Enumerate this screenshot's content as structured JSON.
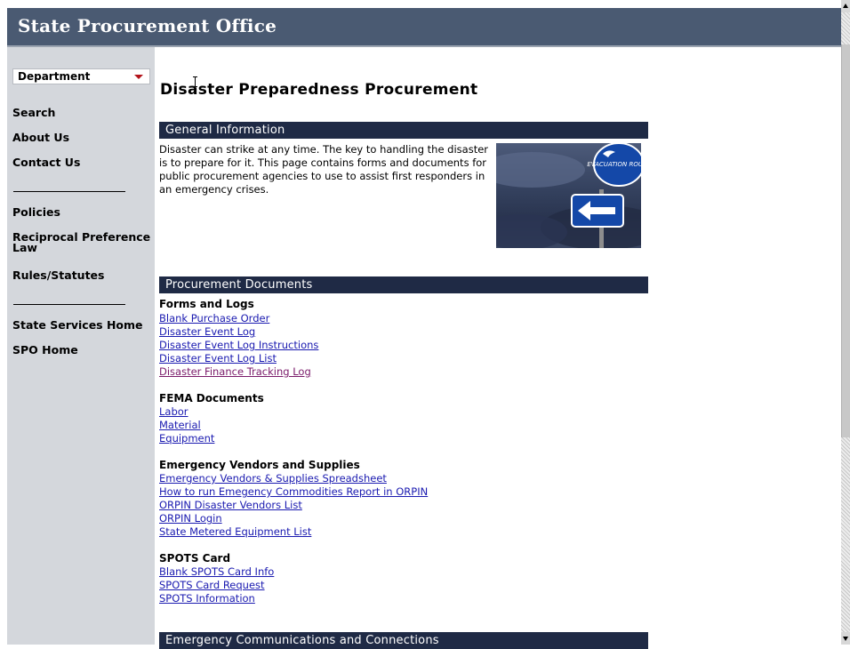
{
  "header": {
    "title": "State Procurement Office"
  },
  "sidebar": {
    "dropdown_value": "Department",
    "items": [
      {
        "label": "Search"
      },
      {
        "label": "About Us"
      },
      {
        "label": "Contact Us"
      },
      {
        "label": "Policies"
      },
      {
        "label": "Reciprocal Preference Law"
      },
      {
        "label": "Rules/Statutes"
      },
      {
        "label": "State Services Home"
      },
      {
        "label": "SPO Home"
      }
    ]
  },
  "main": {
    "page_title": "Disaster Preparedness Procurement",
    "general": {
      "heading": "General Information",
      "text": "Disaster can strike at any time.  The key to handling the disaster is to prepare for it.  This page contains forms and documents for public procurement agencies to use to assist first responders in an emergency crises.",
      "image_sign_text": "EVACUATION ROUTE"
    },
    "procurement": {
      "heading": "Procurement Documents",
      "groups": [
        {
          "title": "Forms and Logs",
          "links": [
            "Blank Purchase Order",
            "Disaster Event Log",
            "Disaster Event Log Instructions",
            "Disaster Event Log List",
            "Disaster Finance Tracking Log"
          ]
        },
        {
          "title": "FEMA Documents",
          "links": [
            "Labor",
            "Material",
            "Equipment"
          ]
        },
        {
          "title": "Emergency Vendors and Supplies",
          "links": [
            "Emergency Vendors & Supplies Spreadsheet",
            "How to run Emegency Commodities Report in ORPIN",
            "ORPIN Disaster Vendors List",
            "ORPIN Login",
            "State Metered Equipment List"
          ]
        },
        {
          "title": "SPOTS Card",
          "links": [
            "Blank SPOTS Card Info",
            "SPOTS Card Request",
            "SPOTS Information"
          ]
        }
      ]
    },
    "communications": {
      "heading": "Emergency Communications and Connections"
    }
  }
}
